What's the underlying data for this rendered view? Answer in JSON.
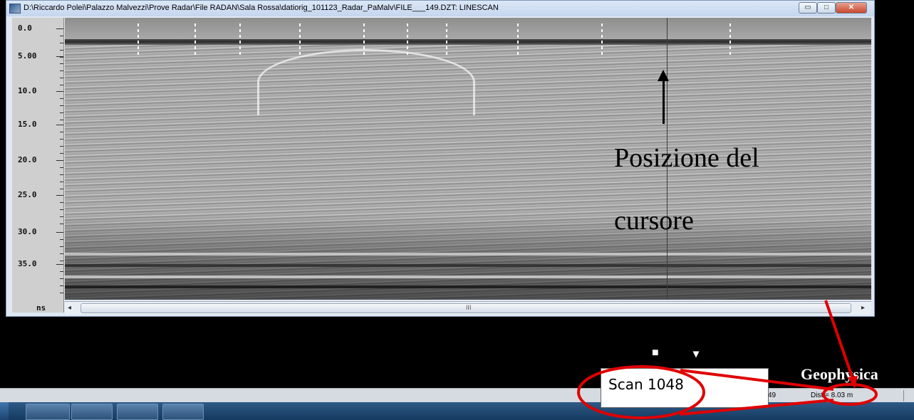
{
  "window": {
    "title": "D:\\Riccardo Polei\\Palazzo Malvezzi\\Prove Radar\\File RADAN\\Sala Rossa\\datiorig_101123_Radar_PaMalv\\FILE___149.DZT:  LINESCAN",
    "minimize": "▭",
    "maximize": "□",
    "close": "✕"
  },
  "depth_scale": {
    "ticks": [
      "0.0",
      "5.00",
      "10.0",
      "15.0",
      "20.0",
      "25.0",
      "30.0",
      "35.0"
    ],
    "unit": "ns"
  },
  "annotation": {
    "line1": "Posizione del",
    "line2": "cursore"
  },
  "scrollbar": {
    "left_arrow": "◂",
    "right_arrow": "▸",
    "grip": "III"
  },
  "scan_readout": {
    "label": "Scan 1048"
  },
  "status_bar": {
    "scan_num": "49",
    "distance": "Dist = 8.03 m"
  },
  "brand_text": "Geophysica",
  "glyphs": {
    "g1": "■",
    "g2": "▾"
  },
  "colors": {
    "highlight": "#e00000",
    "taskbar": "#1f4a78"
  }
}
